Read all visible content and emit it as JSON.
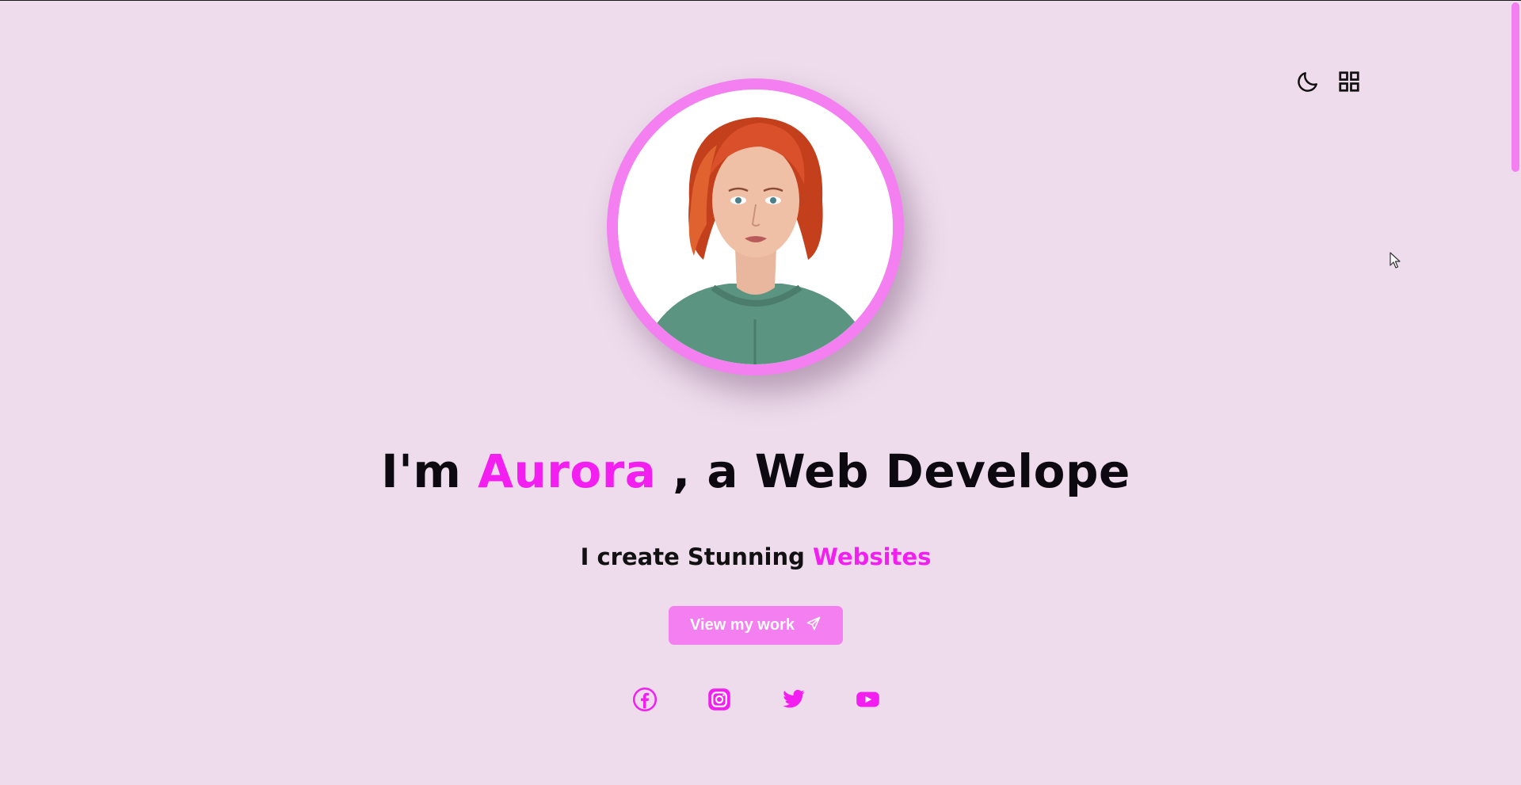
{
  "header": {
    "theme_toggle_icon": "moon-icon",
    "menu_icon": "grid-icon"
  },
  "hero": {
    "avatar_alt": "portrait-avatar",
    "headline_prefix": "I'm",
    "headline_name": "Aurora",
    "headline_suffix": ", a Web Develope",
    "subline_prefix": "I create Stunning",
    "subline_accent": "Websites",
    "cta_label": "View my work",
    "cta_icon": "send-icon"
  },
  "socials": [
    {
      "name": "facebook-icon"
    },
    {
      "name": "instagram-icon"
    },
    {
      "name": "twitter-icon"
    },
    {
      "name": "youtube-icon"
    }
  ],
  "colors": {
    "background": "#eedcec",
    "accent": "#f31ff0",
    "accent_soft": "#f37ff0",
    "text": "#0c0a10"
  }
}
